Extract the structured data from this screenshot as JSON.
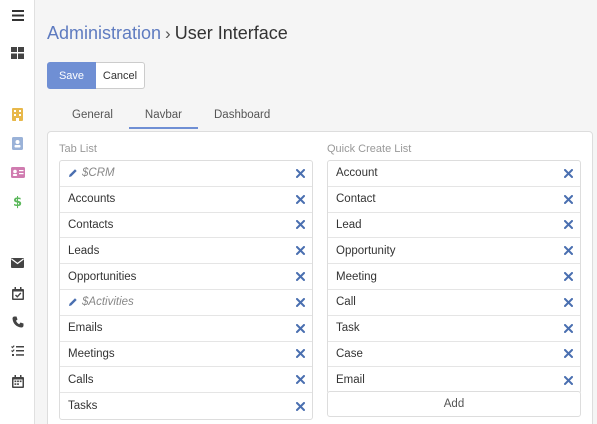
{
  "sidebar": {
    "icons": [
      "menu-icon",
      "dashboard-icon",
      "building-icon",
      "contact-card-icon",
      "id-card-icon",
      "dollar-icon",
      "envelope-icon",
      "calendar-check-icon",
      "phone-icon",
      "task-list-icon",
      "calendar-icon"
    ]
  },
  "breadcrumb": {
    "parent": "Administration",
    "separator": "›",
    "current": "User Interface"
  },
  "buttons": {
    "save": "Save",
    "cancel": "Cancel"
  },
  "tabs": [
    {
      "label": "General",
      "active": false
    },
    {
      "label": "Navbar",
      "active": true
    },
    {
      "label": "Dashboard",
      "active": false
    }
  ],
  "tab_list": {
    "label": "Tab List",
    "items": [
      {
        "label": "$CRM",
        "group": true
      },
      {
        "label": "Accounts",
        "group": false
      },
      {
        "label": "Contacts",
        "group": false
      },
      {
        "label": "Leads",
        "group": false
      },
      {
        "label": "Opportunities",
        "group": false
      },
      {
        "label": "$Activities",
        "group": true
      },
      {
        "label": "Emails",
        "group": false
      },
      {
        "label": "Meetings",
        "group": false
      },
      {
        "label": "Calls",
        "group": false
      },
      {
        "label": "Tasks",
        "group": false
      }
    ]
  },
  "quick_create": {
    "label": "Quick Create List",
    "items": [
      "Account",
      "Contact",
      "Lead",
      "Opportunity",
      "Meeting",
      "Call",
      "Task",
      "Case",
      "Email"
    ],
    "add_label": "Add"
  },
  "colors": {
    "accent": "#6f8fd4",
    "link": "#5e7bc0",
    "remove": "#4a6fb0"
  }
}
